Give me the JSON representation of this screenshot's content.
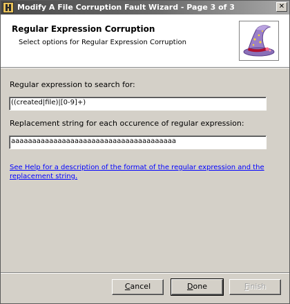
{
  "window": {
    "title": "Modify A File Corruption Fault Wizard - Page 3 of 3",
    "close_glyph": "✕"
  },
  "header": {
    "title": "Regular Expression Corruption",
    "subtitle": "Select options for Regular Expression Corruption"
  },
  "form": {
    "regex_label": "Regular expression to search for:",
    "regex_value": "((created|file)|[0-9]+)",
    "replacement_label": "Replacement string for each occurence of regular expression:",
    "replacement_value": "aaaaaaaaaaaaaaaaaaaaaaaaaaaaaaaaaaaaaaa"
  },
  "help_link": "See Help for a description of the format of the regular expression and the replacement string.",
  "buttons": {
    "cancel": {
      "mnemonic": "C",
      "rest": "ancel"
    },
    "done": {
      "mnemonic": "D",
      "rest": "one"
    },
    "finish": {
      "mnemonic": "F",
      "rest": "inish"
    }
  },
  "icons": {
    "app": "app-icon",
    "wizard": "wizard-hat-icon"
  },
  "colors": {
    "titlebar": "#4a4a4a",
    "header_bg": "#ffffff",
    "dialog_bg": "#d4d0c8",
    "link": "#0000ff",
    "hat_purple": "#9a7fc8",
    "hat_band": "#b01030"
  }
}
